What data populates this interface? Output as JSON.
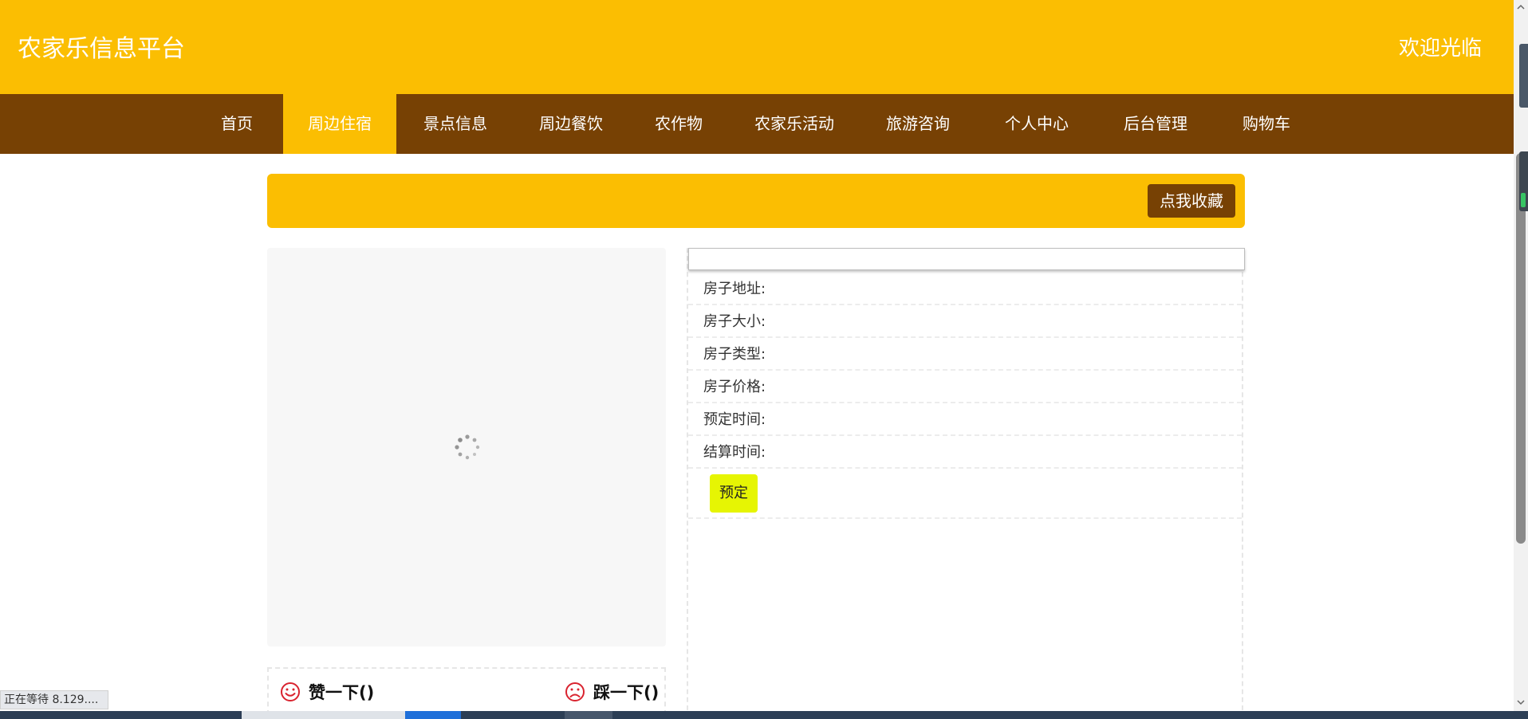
{
  "header": {
    "site_title": "农家乐信息平台",
    "welcome": "欢迎光临"
  },
  "nav": {
    "items": [
      {
        "label": "首页"
      },
      {
        "label": "周边住宿",
        "active": true
      },
      {
        "label": "景点信息"
      },
      {
        "label": "周边餐饮"
      },
      {
        "label": "农作物"
      },
      {
        "label": "农家乐活动"
      },
      {
        "label": "旅游咨询"
      },
      {
        "label": "个人中心"
      },
      {
        "label": "后台管理"
      },
      {
        "label": "购物车"
      }
    ]
  },
  "favorite": {
    "button_label": "点我收藏"
  },
  "details": {
    "name_value": "",
    "rows": [
      {
        "label": "房子地址:",
        "value": ""
      },
      {
        "label": "房子大小:",
        "value": ""
      },
      {
        "label": "房子类型:",
        "value": ""
      },
      {
        "label": "房子价格:",
        "value": ""
      },
      {
        "label": "预定时间:",
        "value": ""
      },
      {
        "label": "结算时间:",
        "value": ""
      }
    ],
    "book_button": "预定"
  },
  "votes": {
    "like_label": "赞一下()",
    "dislike_label": "踩一下()"
  },
  "browser_status": "正在等待 8.129....",
  "colors": {
    "header_bg": "#fbbe02",
    "nav_bg": "#774104",
    "book_button_bg": "#e6f503",
    "vote_icon": "#d9232f"
  },
  "icons": {
    "like": "smile-icon",
    "dislike": "frown-icon",
    "loading": "spinner-icon"
  }
}
